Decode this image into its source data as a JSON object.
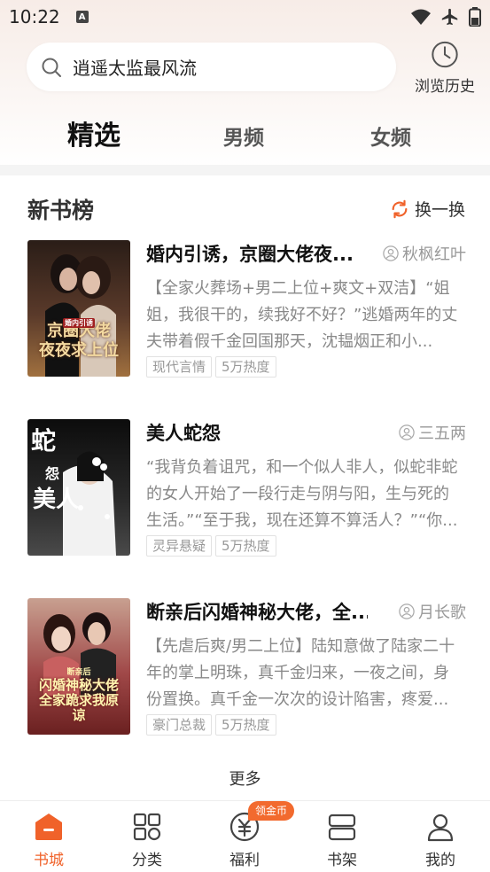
{
  "status_bar": {
    "time": "10:22",
    "notif_icon": "A"
  },
  "search": {
    "query": "逍遥太监最风流"
  },
  "history": {
    "label": "浏览历史"
  },
  "tabs": [
    {
      "label": "精选",
      "active": true
    },
    {
      "label": "男频",
      "active": false
    },
    {
      "label": "女频",
      "active": false
    }
  ],
  "section": {
    "title": "新书榜",
    "refresh_label": "换一换"
  },
  "books": [
    {
      "title": "婚内引诱，京圈大佬夜...",
      "author": "秋枫红叶",
      "desc": "【全家火葬场+男二上位+爽文+双洁】“姐姐，我很干的，续我好不好？”逃婚两年的丈夫带着假千金回国那天，沈韫烟正和小...",
      "tags": [
        "现代言情",
        "5万热度"
      ],
      "cover_title": "婚内引诱\n京圈大佬\n夜夜求上位",
      "cover_colors": [
        "#3a2a22",
        "#8a5a3a"
      ]
    },
    {
      "title": "美人蛇怨",
      "author": "三五两",
      "desc": "“我背负着诅咒，和一个似人非人，似蛇非蛇的女人开始了一段行走与阴与阳，生与死的生活。”“至于我，现在还算不算活人？”“你...",
      "tags": [
        "灵异悬疑",
        "5万热度"
      ],
      "cover_title": "蛇\n怨\n美人",
      "cover_colors": [
        "#141414",
        "#3a3a3a"
      ]
    },
    {
      "title": "断亲后闪婚神秘大佬，全...",
      "author": "月长歌",
      "desc": "【先虐后爽/男二上位】陆知意做了陆家二十年的掌上明珠，真千金归来，一夜之间，身份置换。真千金一次次的设计陷害，疼爱...",
      "tags": [
        "豪门总裁",
        "5万热度"
      ],
      "cover_title": "断亲后\n闪婚神秘大佬\n全家跪求我原谅",
      "cover_colors": [
        "#8a3a3a",
        "#d89a8a"
      ]
    }
  ],
  "more_label": "更多",
  "nav": [
    {
      "label": "书城",
      "active": true
    },
    {
      "label": "分类",
      "active": false
    },
    {
      "label": "福利",
      "active": false,
      "badge": "领金币"
    },
    {
      "label": "书架",
      "active": false
    },
    {
      "label": "我的",
      "active": false
    }
  ],
  "colors": {
    "accent": "#f0622a",
    "text": "#222222",
    "muted": "#999999"
  }
}
